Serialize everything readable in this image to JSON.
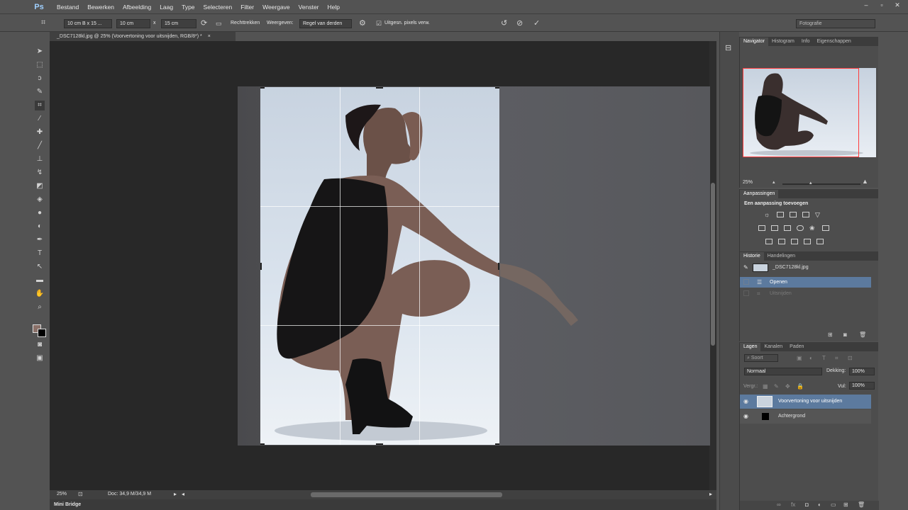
{
  "app": {
    "logo": "Ps"
  },
  "menu": [
    "Bestand",
    "Bewerken",
    "Afbeelding",
    "Laag",
    "Type",
    "Selecteren",
    "Filter",
    "Weergave",
    "Venster",
    "Help"
  ],
  "window_controls": [
    "–",
    "▫",
    "✕"
  ],
  "options": {
    "preset": "10 cm B x 15 ...",
    "width": "10 cm",
    "x": "x",
    "height": "15 cm",
    "straighten": "Rechttrekken",
    "view_label": "Weergeven:",
    "view_value": "Regel van derden",
    "delete_cropped": "Uitgesn. pixels verw.",
    "workspace": "Fotografie"
  },
  "document": {
    "tab_title": "_DSC7128kl.jpg @ 25% (Voorvertoning voor uitsnijden, RGB/8*) *",
    "close": "×"
  },
  "status": {
    "zoom": "25%",
    "doc": "Doc: 34,9 M/34,9 M"
  },
  "mini_bridge": "Mini Bridge",
  "navigator": {
    "tabs": [
      "Navigator",
      "Histogram",
      "Info",
      "Eigenschappen"
    ],
    "zoom": "25%"
  },
  "adjustments": {
    "tab": "Aanpassingen",
    "title": "Een aanpassing toevoegen"
  },
  "history": {
    "tabs": [
      "Historie",
      "Handelingen"
    ],
    "snapshot": "_DSC7128kl.jpg",
    "items": [
      "Openen",
      "Uitsnijden"
    ]
  },
  "layers": {
    "tabs": [
      "Lagen",
      "Kanalen",
      "Paden"
    ],
    "kind": "Soort",
    "blend": "Normaal",
    "opacity_label": "Dekking:",
    "opacity": "100%",
    "lock_label": "Vergr.:",
    "fill_label": "Vul:",
    "fill": "100%",
    "items": [
      "Voorvertoning voor uitsnijden",
      "Achtergrond"
    ]
  },
  "colors": {
    "selection": "#5c7a9e",
    "accent": "#9fd0ff",
    "nav_frame": "#ff3b3b"
  }
}
